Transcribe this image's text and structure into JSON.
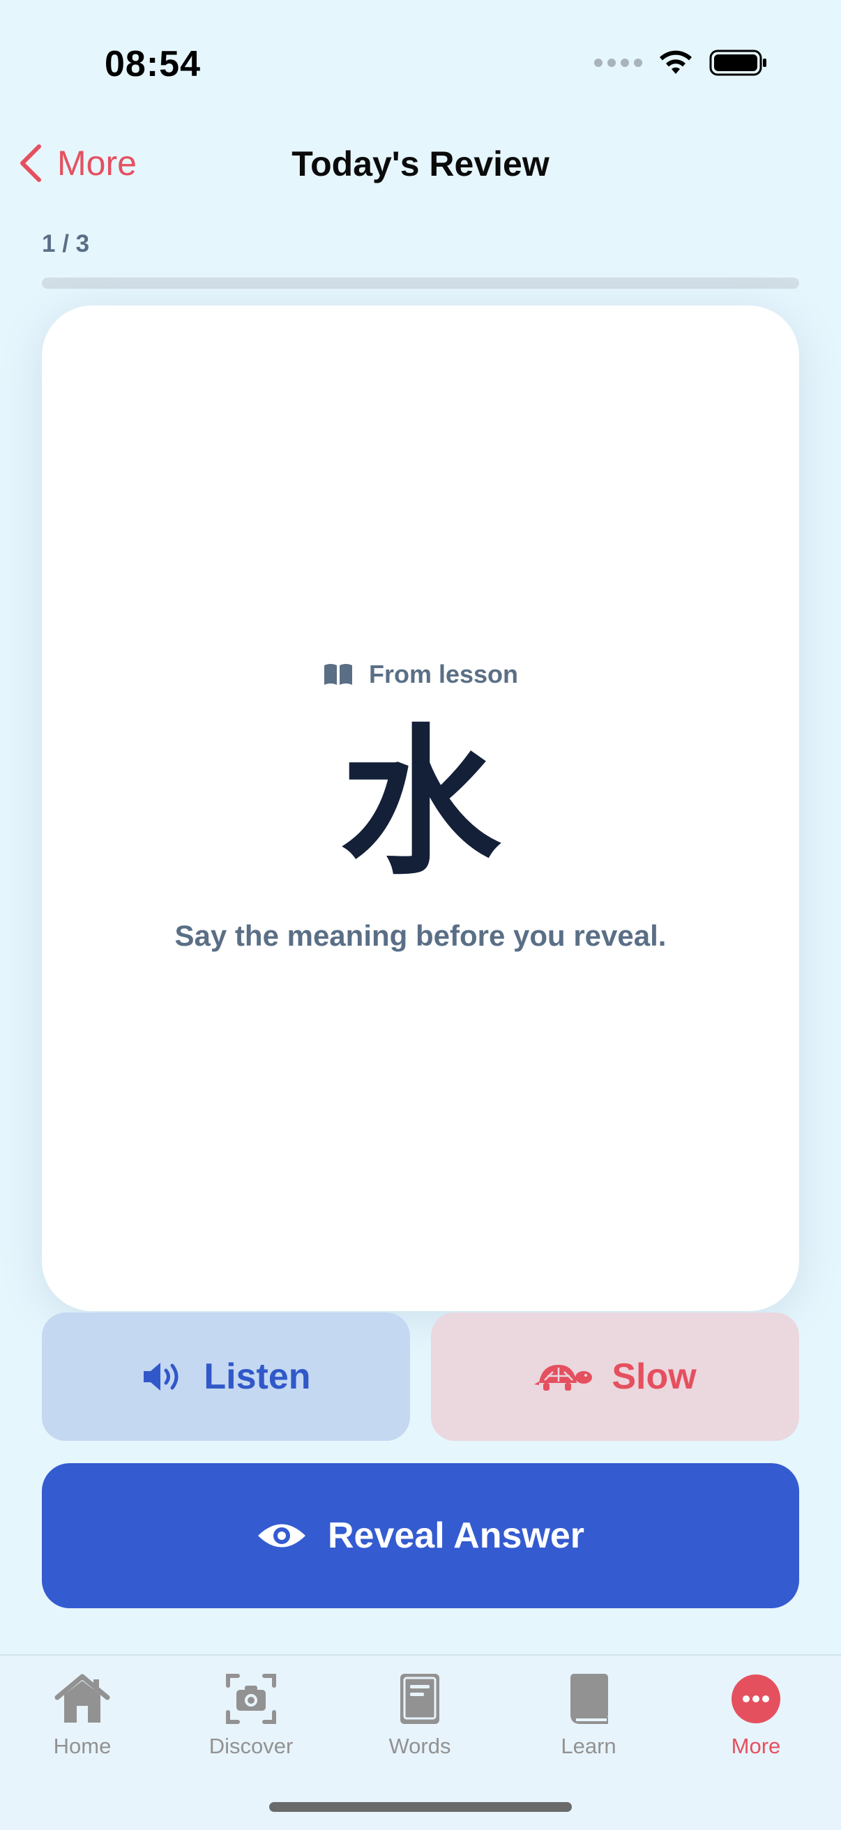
{
  "status_bar": {
    "time": "08:54"
  },
  "nav": {
    "back_label": "More",
    "title": "Today's Review"
  },
  "progress": {
    "label": "1 / 3",
    "value": 0
  },
  "card": {
    "tag_label": "From lesson",
    "character": "水",
    "hint": "Say the meaning before you reveal."
  },
  "actions": {
    "listen_label": "Listen",
    "slow_label": "Slow",
    "reveal_label": "Reveal Answer"
  },
  "tabs": [
    {
      "label": "Home",
      "icon": "home-icon"
    },
    {
      "label": "Discover",
      "icon": "camera-icon"
    },
    {
      "label": "Words",
      "icon": "words-book-icon"
    },
    {
      "label": "Learn",
      "icon": "learn-book-icon"
    },
    {
      "label": "More",
      "icon": "more-icon",
      "active": true
    }
  ],
  "colors": {
    "accent": "#E5505F",
    "primary": "#345BD0",
    "background": "#E6F6FD"
  }
}
